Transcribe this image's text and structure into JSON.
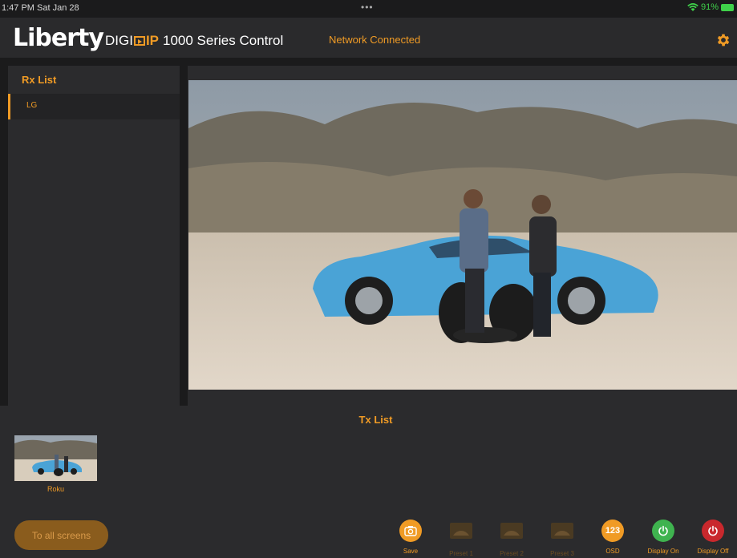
{
  "status_bar": {
    "time": "1:47 PM  Sat Jan 28",
    "dots": "•••",
    "battery": "91%"
  },
  "header": {
    "logo": "Liberty",
    "product_prefix": "DIGI",
    "product_ip": "IP",
    "product_suffix": "1000 Series Control",
    "network_status": "Network Connected"
  },
  "rx_list": {
    "title": "Rx List",
    "items": [
      {
        "label": "LG",
        "selected": true
      }
    ]
  },
  "tx_list": {
    "title": "Tx List",
    "items": [
      {
        "label": "Roku"
      }
    ]
  },
  "all_screens_button": "To all screens",
  "toolbar": {
    "save": "Save",
    "preset1": "Preset 1",
    "preset2": "Preset 2",
    "preset3": "Preset 3",
    "osd": "OSD",
    "osd_icon_text": "123",
    "display_on": "Display On",
    "display_off": "Display Off"
  },
  "colors": {
    "accent": "#f09b25",
    "green": "#3fb34f",
    "red": "#c9282d",
    "panel": "#2b2b2d"
  },
  "icons": {
    "gear": "gear-icon",
    "camera": "camera-icon",
    "power": "power-icon",
    "wifi": "wifi-icon"
  }
}
